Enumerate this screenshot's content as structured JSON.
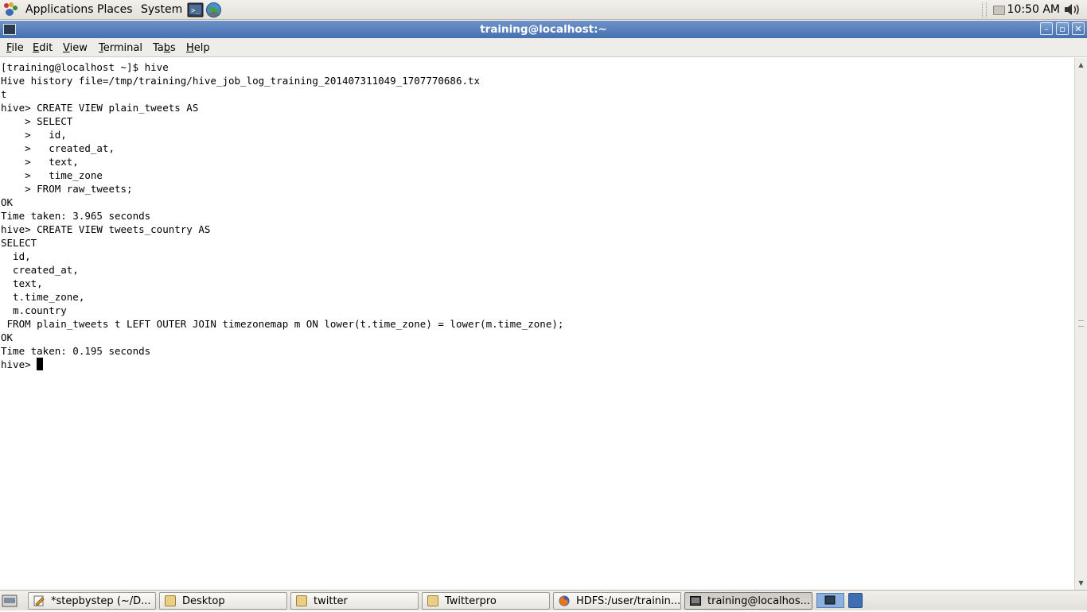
{
  "top_panel": {
    "menus": [
      "Applications",
      "Places",
      "System"
    ],
    "clock": "10:50 AM"
  },
  "window": {
    "title": "training@localhost:~",
    "minimize": "–",
    "maximize": "▫",
    "close": "✕"
  },
  "menubar": {
    "items": [
      {
        "pre": "",
        "u": "F",
        "post": "ile"
      },
      {
        "pre": "",
        "u": "E",
        "post": "dit"
      },
      {
        "pre": "",
        "u": "V",
        "post": "iew"
      },
      {
        "pre": "",
        "u": "T",
        "post": "erminal"
      },
      {
        "pre": "Ta",
        "u": "b",
        "post": "s"
      },
      {
        "pre": "",
        "u": "H",
        "post": "elp"
      }
    ]
  },
  "terminal": {
    "lines": [
      "[training@localhost ~]$ hive",
      "Hive history file=/tmp/training/hive_job_log_training_201407311049_1707770686.tx",
      "t",
      "hive> CREATE VIEW plain_tweets AS",
      "    > SELECT",
      "    >   id,",
      "    >   created_at,",
      "    >   text,",
      "    >   time_zone",
      "    > FROM raw_tweets;",
      "OK",
      "Time taken: 3.965 seconds",
      "hive> CREATE VIEW tweets_country AS",
      "SELECT",
      "  id,",
      "  created_at,",
      "  text,",
      "  t.time_zone,",
      "  m.country",
      " FROM plain_tweets t LEFT OUTER JOIN timezonemap m ON lower(t.time_zone) = lower(m.time_zone);",
      "OK",
      "Time taken: 0.195 seconds"
    ],
    "prompt": "hive> "
  },
  "taskbar": {
    "tasks": [
      {
        "label": "*stepbystep (~/D...",
        "icon": "text-editor-icon"
      },
      {
        "label": "Desktop",
        "icon": "folder-icon"
      },
      {
        "label": "twitter",
        "icon": "folder-icon"
      },
      {
        "label": "Twitterpro",
        "icon": "folder-icon"
      },
      {
        "label": "HDFS:/user/trainin...",
        "icon": "firefox-icon"
      },
      {
        "label": "training@localhos...",
        "icon": "terminal-icon"
      }
    ]
  }
}
